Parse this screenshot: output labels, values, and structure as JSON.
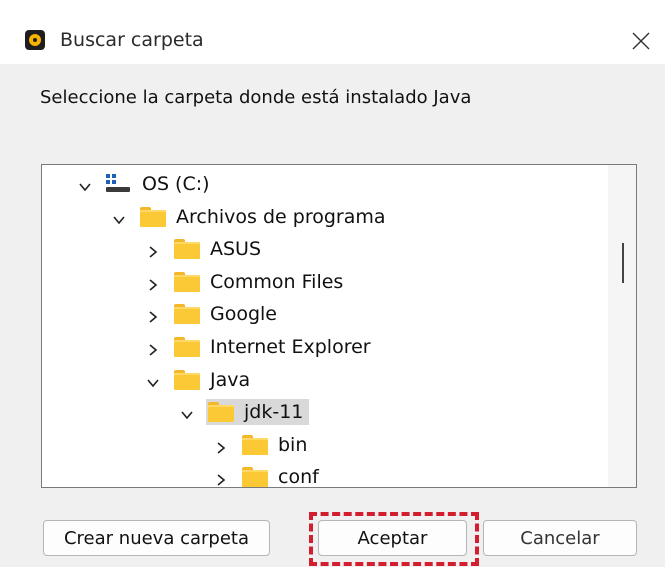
{
  "window": {
    "title": "Buscar carpeta",
    "app_icon": "java-setup-icon",
    "close_icon": "close-icon"
  },
  "prompt": "Seleccione la carpeta donde está instalado Java",
  "tree": {
    "items": [
      {
        "label": "OS (C:)",
        "icon": "drive-icon",
        "expanded": true,
        "level": 0,
        "selected": false
      },
      {
        "label": "Archivos de programa",
        "icon": "folder-icon",
        "expanded": true,
        "level": 1,
        "selected": false
      },
      {
        "label": "ASUS",
        "icon": "folder-icon",
        "expanded": false,
        "level": 2,
        "selected": false
      },
      {
        "label": "Common Files",
        "icon": "folder-icon",
        "expanded": false,
        "level": 2,
        "selected": false
      },
      {
        "label": "Google",
        "icon": "folder-icon",
        "expanded": false,
        "level": 2,
        "selected": false
      },
      {
        "label": "Internet Explorer",
        "icon": "folder-icon",
        "expanded": false,
        "level": 2,
        "selected": false
      },
      {
        "label": "Java",
        "icon": "folder-icon",
        "expanded": true,
        "level": 2,
        "selected": false
      },
      {
        "label": "jdk-11",
        "icon": "folder-icon",
        "expanded": true,
        "level": 3,
        "selected": true
      },
      {
        "label": "bin",
        "icon": "folder-icon",
        "expanded": false,
        "level": 4,
        "selected": false
      },
      {
        "label": "conf",
        "icon": "folder-icon",
        "expanded": false,
        "level": 4,
        "selected": false
      }
    ]
  },
  "buttons": {
    "new_folder": "Crear nueva carpeta",
    "ok": "Aceptar",
    "cancel": "Cancelar"
  },
  "colors": {
    "highlight": "#d21e2f",
    "folder": "#fcc936",
    "selection": "#d9d9d9"
  }
}
